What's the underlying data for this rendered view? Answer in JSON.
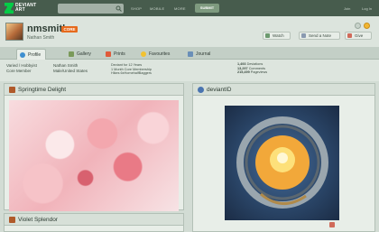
{
  "topbar": {
    "logo_line1": "DEVIANT",
    "logo_line2": "ART",
    "nav": [
      "SHOP",
      "MOBILE",
      "MORE"
    ],
    "submit": "SUBMIT",
    "join": "Join",
    "login": "Log In"
  },
  "profile": {
    "username": "nmsmith",
    "badge": "CORE",
    "realname": "Nathan Smith",
    "buttons": [
      "Watch",
      "Send a Note",
      "Give"
    ]
  },
  "tabs": [
    {
      "label": "Profile",
      "active": true
    },
    {
      "label": "Gallery",
      "active": false
    },
    {
      "label": "Prints",
      "active": false
    },
    {
      "label": "Favourites",
      "active": false
    },
    {
      "label": "Journal",
      "active": false
    }
  ],
  "info": {
    "role_line1": "Varied / Hobbyist",
    "role_line2": "Core Member",
    "person_line1": "Nathan Smith",
    "person_line2": "Male/United States",
    "member_line1": "Deviant for 12 Years",
    "member_line2": "1 Month Core Membership",
    "member_line3": "Hikes 6xHomehalfBaggers",
    "stats_line1_num": "1,493",
    "stats_line1_label": "Deviations",
    "stats_line2_num": "13,297",
    "stats_line2_label": "Comments",
    "stats_line3_num": "215,499",
    "stats_line3_label": "Pageviews"
  },
  "panels": {
    "featured_title": "Springtime Delight",
    "deviantid_title": "deviantID",
    "second_title": "Violet Splendor"
  },
  "colors": {
    "topbar": "#475c4d",
    "accent": "#05cc47",
    "badge": "#e66a1d"
  }
}
